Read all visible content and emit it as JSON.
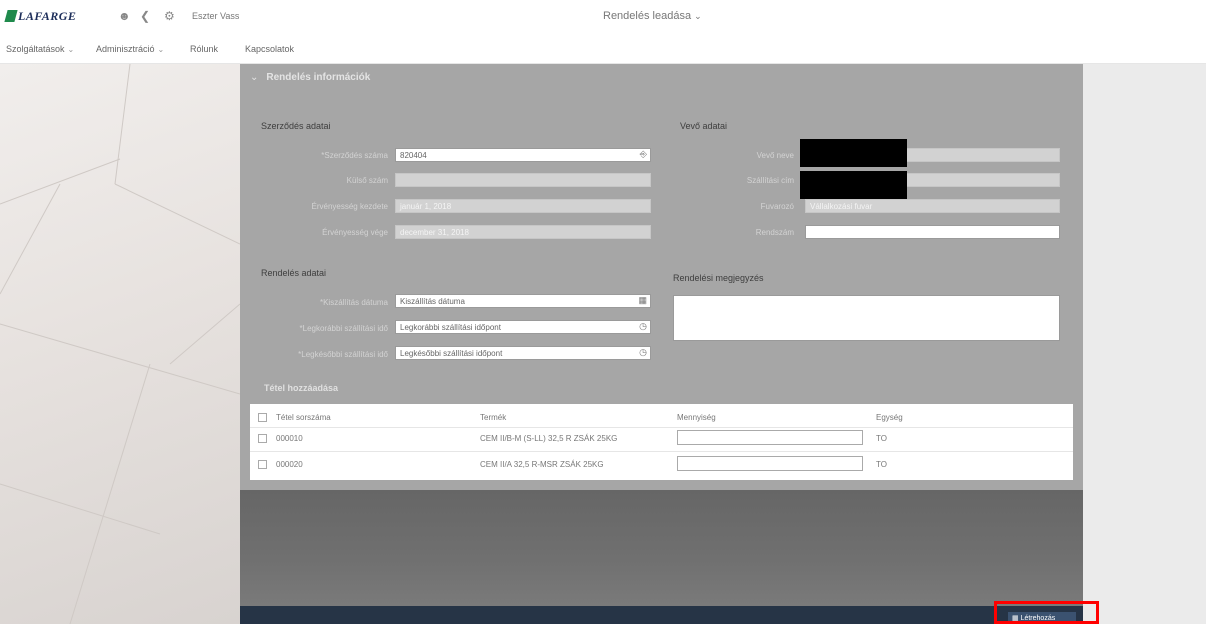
{
  "topbar": {
    "logo_text": "LAFARGE",
    "user_name": "Eszter Vass",
    "page_title": "Rendelés leadása",
    "icons": {
      "user": "user-icon",
      "back": "back-icon",
      "settings": "settings-icon"
    }
  },
  "menu": {
    "items": [
      {
        "label": "Szolgáltatások",
        "has_dropdown": true
      },
      {
        "label": "Adminisztráció",
        "has_dropdown": true
      },
      {
        "label": "Rólunk",
        "has_dropdown": false
      },
      {
        "label": "Kapcsolatok",
        "has_dropdown": false
      }
    ]
  },
  "section": {
    "title": "Rendelés információk"
  },
  "contract": {
    "title": "Szerződés adatai",
    "fields": [
      {
        "label": "*Szerződés száma",
        "value": "820404",
        "readonly": false
      },
      {
        "label": "Külső szám",
        "value": "",
        "readonly": true
      },
      {
        "label": "Érvényesség kezdete",
        "value": "január 1, 2018",
        "readonly": true
      },
      {
        "label": "Érvényesség vége",
        "value": "december 31, 2018",
        "readonly": true
      }
    ]
  },
  "buyer": {
    "title": "Vevő adatai",
    "fields": [
      {
        "label": "Vevő neve",
        "value": "",
        "readonly": true
      },
      {
        "label": "Szállítási cím",
        "value": "",
        "readonly": true
      },
      {
        "label": "Fuvarozó",
        "value": "Vállalkozási fuvar",
        "readonly": true
      },
      {
        "label": "Rendszám",
        "value": "",
        "readonly": false
      }
    ]
  },
  "order": {
    "title": "Rendelés adatai",
    "fields": [
      {
        "label": "*Kiszállítás dátuma",
        "value": "Kiszállítás dátuma"
      },
      {
        "label": "*Legkorábbi szállítási idő",
        "value": "Legkorábbi szállítási időpont"
      },
      {
        "label": "*Legkésőbbi szállítási idő",
        "value": "Legkésőbbi szállítási időpont"
      }
    ]
  },
  "note": {
    "title": "Rendelési megjegyzés",
    "value": ""
  },
  "items": {
    "title": "Tétel hozzáadása",
    "columns": [
      "Tétel sorszáma",
      "Termék",
      "Mennyiség",
      "Egység"
    ],
    "rows": [
      {
        "number": "000010",
        "product": "CEM II/B-M (S-LL) 32,5 R ZSÁK 25KG",
        "quantity": "",
        "unit": "TO"
      },
      {
        "number": "000020",
        "product": "CEM II/A 32,5 R-MSR ZSÁK 25KG",
        "quantity": "",
        "unit": "TO"
      }
    ]
  },
  "footer": {
    "submit_label": "Létrehozás",
    "submit_icon": "save-icon"
  },
  "colors": {
    "accent": "#263446",
    "brand_green": "#1f8a4c",
    "highlight": "#ff0000"
  }
}
